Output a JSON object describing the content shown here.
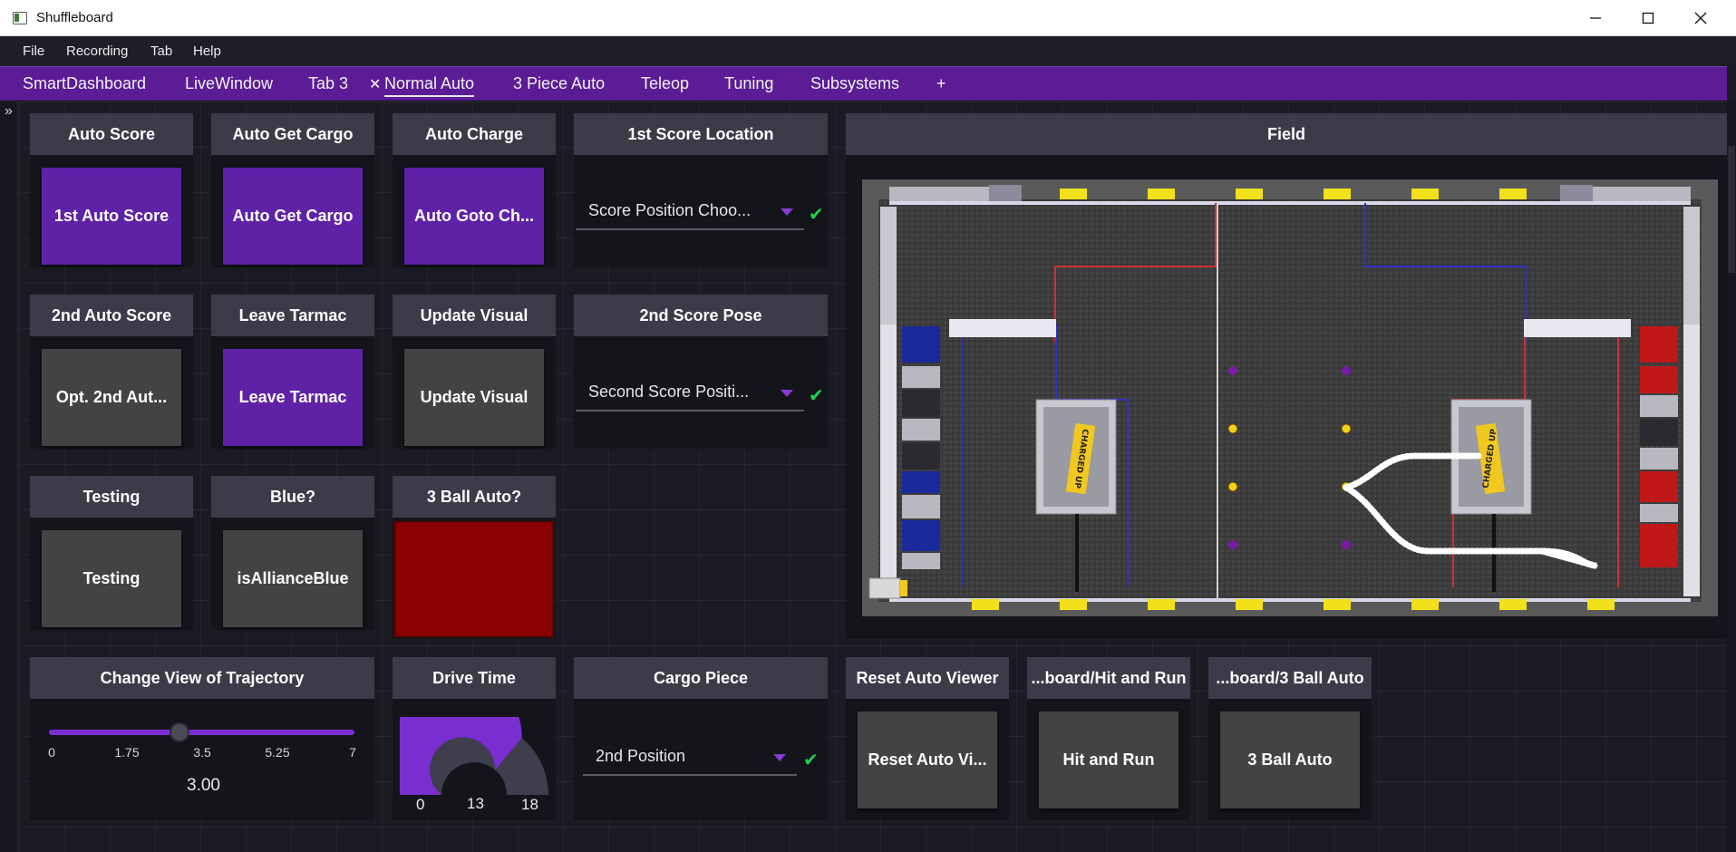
{
  "window": {
    "title": "Shuffleboard"
  },
  "menu": [
    "File",
    "Recording",
    "Tab",
    "Help"
  ],
  "tabs": [
    "SmartDashboard",
    "LiveWindow",
    "Tab 3",
    "Normal Auto",
    "3 Piece Auto",
    "Teleop",
    "Tuning",
    "Subsystems"
  ],
  "active_tab_index": 3,
  "tab_add_label": "+",
  "sidebar_expand_label": "»",
  "widgets": {
    "auto_score": {
      "title": "Auto Score",
      "button": "1st Auto Score",
      "button_color": "#5f22a6"
    },
    "auto_get_cargo": {
      "title": "Auto Get Cargo",
      "button": "Auto Get Cargo",
      "button_color": "#5f22a6"
    },
    "auto_charge": {
      "title": "Auto Charge",
      "button": "Auto Goto Ch...",
      "button_color": "#5f22a6"
    },
    "score_location_1": {
      "title": "1st Score Location",
      "value": "Score Position Choo..."
    },
    "field": {
      "title": "Field",
      "field_label_left": "CHARGED UP",
      "field_label_right": "CHARGED UP"
    },
    "auto_score_2": {
      "title": "2nd Auto Score",
      "button": "Opt. 2nd Aut...",
      "button_color": "#434343"
    },
    "leave_tarmac": {
      "title": "Leave Tarmac",
      "button": "Leave Tarmac",
      "button_color": "#5f22a6"
    },
    "update_visual": {
      "title": "Update Visual",
      "button": "Update Visual",
      "button_color": "#434343"
    },
    "score_pose_2": {
      "title": "2nd Score Pose",
      "value": "Second Score Positi..."
    },
    "testing": {
      "title": "Testing",
      "button": "Testing",
      "button_color": "#434343"
    },
    "blue": {
      "title": "Blue?",
      "button": "isAllianceBlue",
      "button_color": "#434343"
    },
    "ball_auto_3": {
      "title": "3 Ball Auto?",
      "value": false,
      "color_false": "#8b0000"
    },
    "trajectory_view": {
      "title": "Change View of Trajectory",
      "ticks": [
        "0",
        "1.75",
        "3.5",
        "5.25",
        "7"
      ],
      "value": 3.0,
      "value_text": "3.00",
      "min": 0,
      "max": 7
    },
    "drive_time": {
      "title": "Drive Time",
      "min": 0,
      "max": 18,
      "value": 13,
      "min_text": "0",
      "max_text": "18",
      "value_text": "13"
    },
    "cargo_piece": {
      "title": "Cargo Piece",
      "value": "2nd Position"
    },
    "reset_auto_viewer": {
      "title": "Reset Auto Viewer",
      "button": "Reset Auto Vi..."
    },
    "hit_and_run": {
      "title": "...board/Hit and Run",
      "button": "Hit and Run"
    },
    "three_ball_auto": {
      "title": "...board/3 Ball Auto",
      "button": "3 Ball Auto"
    }
  },
  "colors": {
    "accent_purple": "#5b1c96",
    "button_purple": "#5f22a6",
    "check_green": "#1ed24e"
  }
}
